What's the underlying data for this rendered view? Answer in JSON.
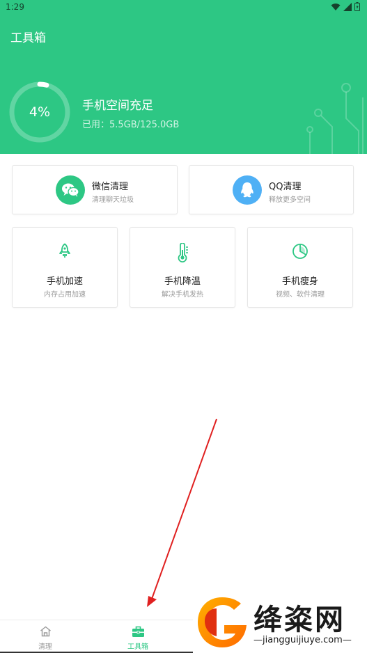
{
  "status_bar": {
    "time": "1:29"
  },
  "header": {
    "title": "工具箱",
    "storage_percent": "4%",
    "storage_fraction": 0.04,
    "storage_title": "手机空间充足",
    "storage_used": "已用：5.5GB/125.0GB"
  },
  "cards_wide": [
    {
      "title": "微信清理",
      "sub": "清理聊天垃圾",
      "icon": "wechat-icon",
      "color": "#2dc784"
    },
    {
      "title": "QQ清理",
      "sub": "释放更多空间",
      "icon": "qq-icon",
      "color": "#4fb0f5"
    }
  ],
  "cards_small": [
    {
      "title": "手机加速",
      "sub": "内存占用加速",
      "icon": "rocket-icon"
    },
    {
      "title": "手机降温",
      "sub": "解决手机发热",
      "icon": "thermometer-icon"
    },
    {
      "title": "手机瘦身",
      "sub": "视频、软件清理",
      "icon": "pie-chart-icon"
    }
  ],
  "bottom_nav": [
    {
      "label": "清理",
      "icon": "home-icon",
      "active": false
    },
    {
      "label": "工具箱",
      "icon": "toolbox-icon",
      "active": true
    }
  ],
  "watermark": {
    "text": "绛粢网",
    "url": "jiangguijiuye.com"
  },
  "colors": {
    "brand": "#2dc784",
    "qq": "#4fb0f5",
    "annotation_arrow": "#e02020"
  }
}
